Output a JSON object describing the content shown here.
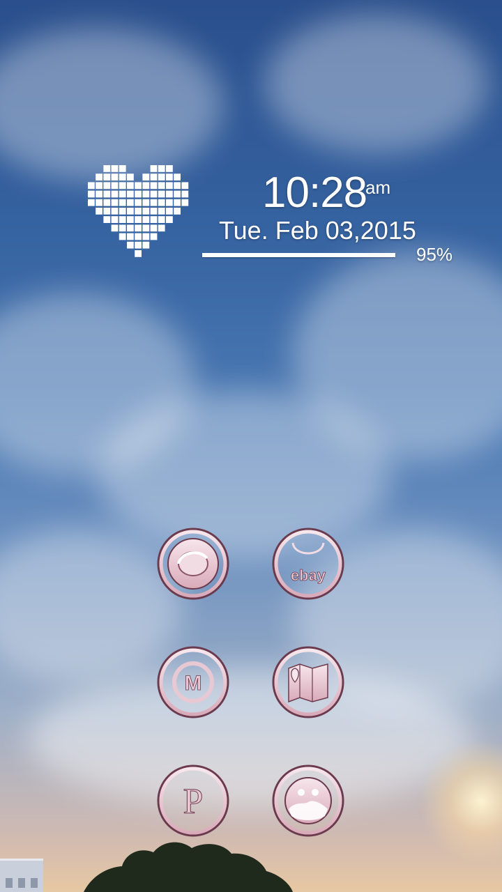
{
  "clock": {
    "time": "10:28",
    "ampm": "am",
    "date": "Tue. Feb 03,2015"
  },
  "battery": {
    "percent_text": "95%",
    "level": 0.95
  },
  "apps": [
    {
      "name": "opera-icon",
      "label": ""
    },
    {
      "name": "ebay-icon",
      "label": "ebay"
    },
    {
      "name": "m-icon",
      "label": "M"
    },
    {
      "name": "maps-icon",
      "label": ""
    },
    {
      "name": "p-icon",
      "label": "P"
    },
    {
      "name": "gallery-icon",
      "label": ""
    }
  ],
  "colors": {
    "icon_pink": "#e8c9d3",
    "icon_dark": "#6b3a4d"
  }
}
